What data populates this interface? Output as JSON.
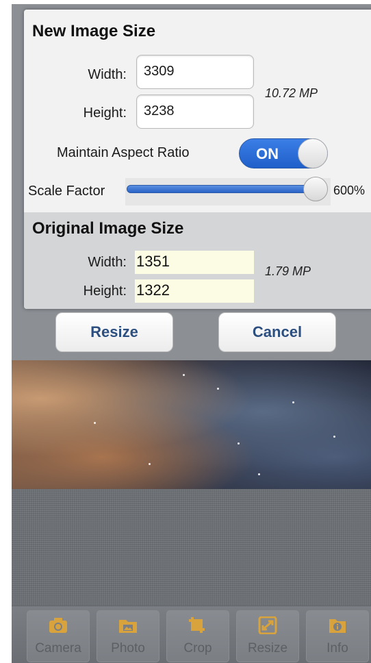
{
  "dialog": {
    "new_size_title": "New Image Size",
    "width_label": "Width:",
    "height_label": "Height:",
    "new_width": "3309",
    "new_height": "3238",
    "new_mp": "10.72 MP",
    "aspect_label": "Maintain Aspect Ratio",
    "aspect_toggle": "ON",
    "scale_label": "Scale Factor",
    "scale_value": "600%",
    "scale_level": 1.0,
    "original_title": "Original Image Size",
    "orig_width": "1351",
    "orig_height": "1322",
    "orig_mp": "1.79 MP",
    "resize_button": "Resize",
    "cancel_button": "Cancel"
  },
  "toolbar": {
    "items": [
      {
        "label": "Camera",
        "icon": "camera-icon"
      },
      {
        "label": "Photo",
        "icon": "photo-folder-icon"
      },
      {
        "label": "Crop",
        "icon": "crop-icon"
      },
      {
        "label": "Resize",
        "icon": "resize-icon"
      },
      {
        "label": "Info",
        "icon": "info-icon"
      }
    ]
  },
  "colors": {
    "accent_blue": "#2a63c6",
    "button_text": "#2c4f80",
    "toolbar_icon": "#d8a23c"
  }
}
